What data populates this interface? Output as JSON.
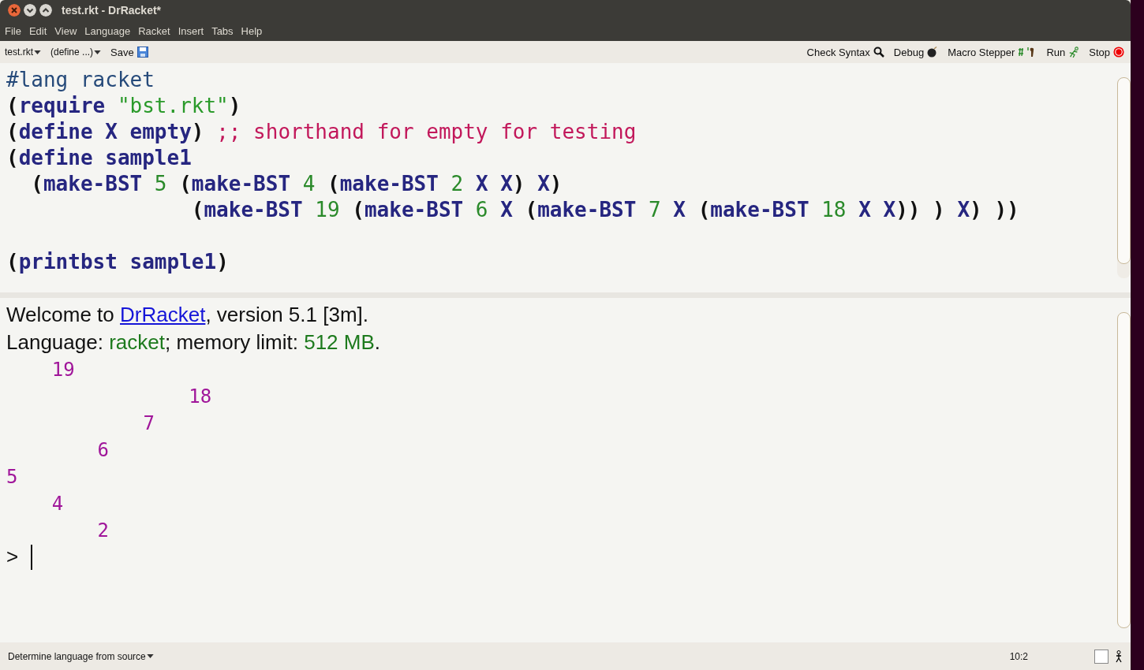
{
  "window": {
    "title": "test.rkt - DrRacket*"
  },
  "menu": [
    "File",
    "Edit",
    "View",
    "Language",
    "Racket",
    "Insert",
    "Tabs",
    "Help"
  ],
  "toolbar": {
    "file_menu": "test.rkt",
    "define_menu": "(define ...)",
    "save": "Save",
    "buttons": [
      {
        "label": "Check Syntax",
        "kind": "search"
      },
      {
        "label": "Debug",
        "kind": "bomb"
      },
      {
        "label": "Macro Stepper",
        "kind": "foot"
      },
      {
        "label": "Run",
        "kind": "runner"
      },
      {
        "label": "Stop",
        "kind": "stop"
      }
    ]
  },
  "editor": {
    "lines": [
      {
        "kind": "code",
        "tokens": [
          {
            "text": "#lang racket",
            "kind": "lang"
          }
        ]
      },
      {
        "kind": "code",
        "tokens": [
          {
            "text": "(",
            "kind": "paren"
          },
          {
            "text": "require ",
            "kind": "id"
          },
          {
            "text": "\"bst.rkt\"",
            "kind": "str"
          },
          {
            "text": ")",
            "kind": "paren"
          }
        ]
      },
      {
        "kind": "code",
        "tokens": [
          {
            "text": "(",
            "kind": "paren"
          },
          {
            "text": "define ",
            "kind": "id"
          },
          {
            "text": "X ",
            "kind": "id"
          },
          {
            "text": "empty",
            "kind": "id"
          },
          {
            "text": ") ",
            "kind": "paren"
          },
          {
            "text": ";; shorthand for empty for testing",
            "kind": "comment"
          }
        ]
      },
      {
        "kind": "code",
        "tokens": [
          {
            "text": "(",
            "kind": "paren"
          },
          {
            "text": "define ",
            "kind": "id"
          },
          {
            "text": "sample1",
            "kind": "id"
          }
        ]
      },
      {
        "kind": "code",
        "tokens": [
          {
            "text": "  (",
            "kind": "paren"
          },
          {
            "text": "make-BST ",
            "kind": "id"
          },
          {
            "text": "5 ",
            "kind": "num"
          },
          {
            "text": "(",
            "kind": "paren"
          },
          {
            "text": "make-BST ",
            "kind": "id"
          },
          {
            "text": "4 ",
            "kind": "num"
          },
          {
            "text": "(",
            "kind": "paren"
          },
          {
            "text": "make-BST ",
            "kind": "id"
          },
          {
            "text": "2 ",
            "kind": "num"
          },
          {
            "text": "X ",
            "kind": "id"
          },
          {
            "text": "X",
            "kind": "id"
          },
          {
            "text": ") ",
            "kind": "paren"
          },
          {
            "text": "X",
            "kind": "id"
          },
          {
            "text": ")",
            "kind": "paren"
          }
        ]
      },
      {
        "kind": "code",
        "tokens": [
          {
            "text": "               (",
            "kind": "paren"
          },
          {
            "text": "make-BST ",
            "kind": "id"
          },
          {
            "text": "19 ",
            "kind": "num"
          },
          {
            "text": "(",
            "kind": "paren"
          },
          {
            "text": "make-BST ",
            "kind": "id"
          },
          {
            "text": "6 ",
            "kind": "num"
          },
          {
            "text": "X ",
            "kind": "id"
          },
          {
            "text": "(",
            "kind": "paren"
          },
          {
            "text": "make-BST ",
            "kind": "id"
          },
          {
            "text": "7 ",
            "kind": "num"
          },
          {
            "text": "X ",
            "kind": "id"
          },
          {
            "text": "(",
            "kind": "paren"
          },
          {
            "text": "make-BST ",
            "kind": "id"
          },
          {
            "text": "18 ",
            "kind": "num"
          },
          {
            "text": "X ",
            "kind": "id"
          },
          {
            "text": "X",
            "kind": "id"
          },
          {
            "text": ")) ) ",
            "kind": "paren"
          },
          {
            "text": "X",
            "kind": "id"
          },
          {
            "text": ") ))",
            "kind": "paren"
          }
        ]
      },
      {
        "kind": "blank"
      },
      {
        "kind": "code",
        "tokens": [
          {
            "text": "(",
            "kind": "paren"
          },
          {
            "text": "printbst ",
            "kind": "id"
          },
          {
            "text": "sample1",
            "kind": "id"
          },
          {
            "text": ")",
            "kind": "paren"
          }
        ]
      }
    ]
  },
  "interactions": {
    "banner": [
      [
        {
          "text": "Welcome to ",
          "kind": "plain"
        },
        {
          "text": "DrRacket",
          "kind": "link"
        },
        {
          "text": ", version 5.1 [3m].",
          "kind": "plain"
        }
      ],
      [
        {
          "text": "Language: ",
          "kind": "plain"
        },
        {
          "text": "racket",
          "kind": "value"
        },
        {
          "text": "; memory limit: ",
          "kind": "plain"
        },
        {
          "text": "512 MB",
          "kind": "value"
        },
        {
          "text": ".",
          "kind": "plain"
        }
      ]
    ],
    "output": [
      "    19",
      "                18",
      "            7",
      "        6",
      "5",
      "    4",
      "        2"
    ],
    "prompt": ">"
  },
  "status_bar": {
    "language": "Determine language from source",
    "position": "10:2"
  }
}
